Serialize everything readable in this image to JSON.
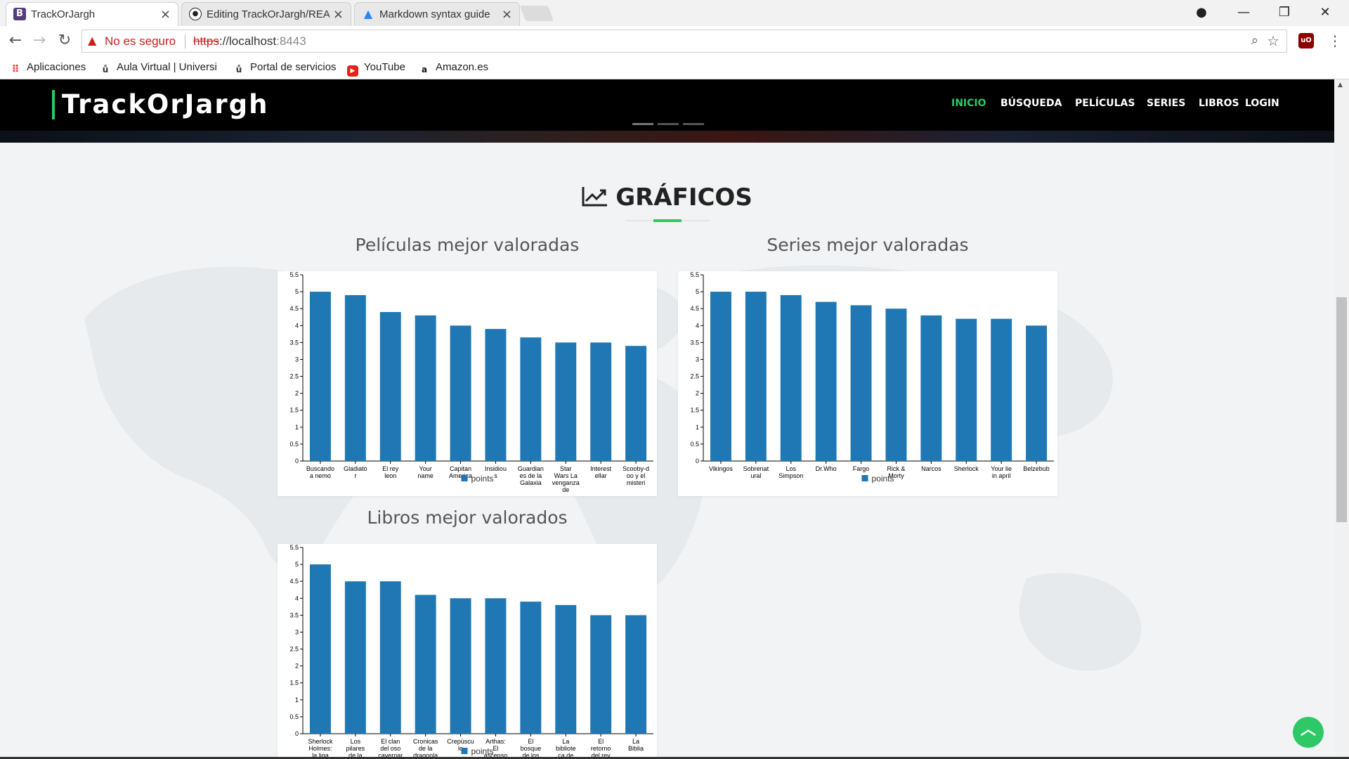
{
  "browser": {
    "tabs": [
      {
        "title": "TrackOrJargh",
        "favicon": "bootstrap-icon",
        "active": true
      },
      {
        "title": "Editing TrackOrJargh/README.md",
        "favicon": "github-icon",
        "active": false
      },
      {
        "title": "Markdown syntax guide",
        "favicon": "atlassian-icon",
        "active": false
      }
    ],
    "address": {
      "security_label": "No es seguro",
      "scheme": "https",
      "host": "://localhost",
      "port": ":8443"
    },
    "bookmarks": [
      {
        "label": "Aplicaciones",
        "icon": "apps-grid-icon"
      },
      {
        "label": "Aula Virtual | Universi",
        "icon": "university-icon"
      },
      {
        "label": "Portal de servicios",
        "icon": "university-icon"
      },
      {
        "label": "YouTube",
        "icon": "youtube-icon"
      },
      {
        "label": "Amazon.es",
        "icon": "amazon-icon"
      }
    ],
    "extension_label": "uO"
  },
  "site": {
    "brand": "TrackOrJargh",
    "nav": [
      {
        "label": "INICIO",
        "active": true
      },
      {
        "label": "BÚSQUEDA",
        "active": false
      },
      {
        "label": "PELÍCULAS",
        "active": false
      },
      {
        "label": "SERIES",
        "active": false
      },
      {
        "label": "LIBROS",
        "active": false
      },
      {
        "label": "LOGIN",
        "active": false
      }
    ],
    "accent_color": "#2ec866",
    "section_title": "GRÁFICOS",
    "charts": [
      {
        "title": "Películas mejor valoradas"
      },
      {
        "title": "Series mejor valoradas"
      },
      {
        "title": "Libros mejor valorados"
      }
    ]
  },
  "chart_data": [
    {
      "type": "bar",
      "title": "Películas mejor valoradas",
      "categories": [
        "Buscando a nemo",
        "Gladiator",
        "El rey leon",
        "Your name",
        "Capitan America",
        "Insidious",
        "Guardianes de la Galaxia",
        "Star Wars La venganza de",
        "Interestellar",
        "Scooby-doo y el misteri"
      ],
      "series": [
        {
          "name": "points",
          "values": [
            5,
            4.9,
            4.4,
            4.3,
            4,
            3.9,
            3.65,
            3.5,
            3.5,
            3.4
          ]
        }
      ],
      "ylim": [
        0,
        5.5
      ],
      "yticks": [
        "0",
        "0.5",
        "1",
        "1.5",
        "2",
        "2.5",
        "3",
        "3.5",
        "4",
        "4.5",
        "5",
        "5.5"
      ],
      "bar_color": "#1f77b4",
      "legend": "bottom"
    },
    {
      "type": "bar",
      "title": "Series mejor valoradas",
      "categories": [
        "Vikingos",
        "Sobrenatural",
        "Los Simpson",
        "Dr.Who",
        "Fargo",
        "Rick & Morty",
        "Narcos",
        "Sherlock",
        "Your lie in april",
        "Belzebub"
      ],
      "series": [
        {
          "name": "points",
          "values": [
            5,
            5,
            4.9,
            4.7,
            4.6,
            4.5,
            4.3,
            4.2,
            4.2,
            4
          ]
        }
      ],
      "ylim": [
        0,
        5.5
      ],
      "yticks": [
        "0",
        "0.5",
        "1",
        "1.5",
        "2",
        "2.5",
        "3",
        "3.5",
        "4",
        "4.5",
        "5",
        "5.5"
      ],
      "bar_color": "#1f77b4",
      "legend": "bottom"
    },
    {
      "type": "bar",
      "title": "Libros mejor valorados",
      "categories": [
        "Sherlock Holmes: la liga",
        "Los pilares de la",
        "El clan del oso cavernario",
        "Cronicas de la dragonlan",
        "Crepúsculo",
        "Arthas: El ascenso",
        "El bosque de los",
        "La biblioteca de los",
        "El retorno del rey",
        "La Biblia"
      ],
      "series": [
        {
          "name": "points",
          "values": [
            5,
            4.5,
            4.5,
            4.1,
            4,
            4,
            3.9,
            3.8,
            3.5,
            3.5
          ]
        }
      ],
      "ylim": [
        0,
        5.5
      ],
      "yticks": [
        "0",
        "0.5",
        "1",
        "1.5",
        "2",
        "2.5",
        "3",
        "3.5",
        "4",
        "4.5",
        "5",
        "5.5"
      ],
      "bar_color": "#1f77b4",
      "legend": "bottom"
    }
  ]
}
